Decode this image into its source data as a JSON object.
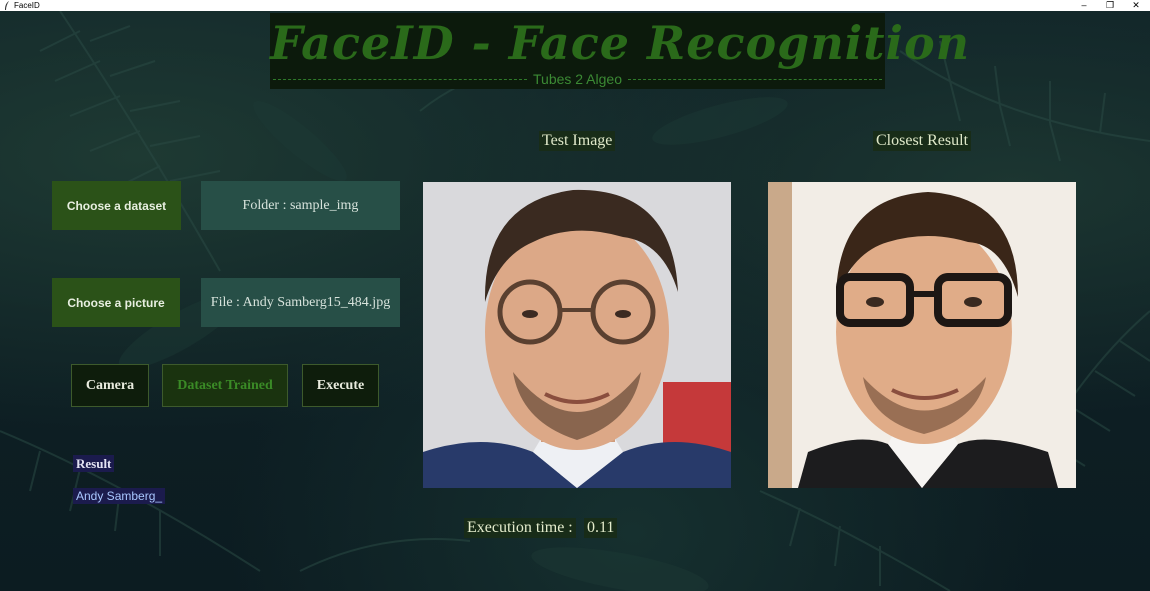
{
  "window": {
    "title": "FaceID",
    "controls": {
      "minimize": "–",
      "maximize": "❐",
      "close": "✕"
    }
  },
  "header": {
    "title": "FaceID - Face Recognition",
    "subtitle": "Tubes 2 Algeo"
  },
  "dataset": {
    "button_label": "Choose a dataset",
    "field_value": "Folder : sample_img"
  },
  "picture": {
    "button_label": "Choose a picture",
    "field_value": "File : Andy Samberg15_484.jpg"
  },
  "actions": {
    "camera_label": "Camera",
    "trained_label": "Dataset Trained",
    "execute_label": "Execute"
  },
  "result": {
    "label": "Result",
    "value": "Andy Samberg_"
  },
  "images": {
    "test_label": "Test Image",
    "closest_label": "Closest Result"
  },
  "execution": {
    "label": "Execution time :",
    "value": "0.11"
  },
  "colors": {
    "background": "#0f2226",
    "title_green": "#2a6a1a",
    "button_green": "#2b5218",
    "field_teal": "#274f47",
    "result_navy": "#1b1b4d"
  },
  "icons": {
    "app": "feather-icon"
  }
}
